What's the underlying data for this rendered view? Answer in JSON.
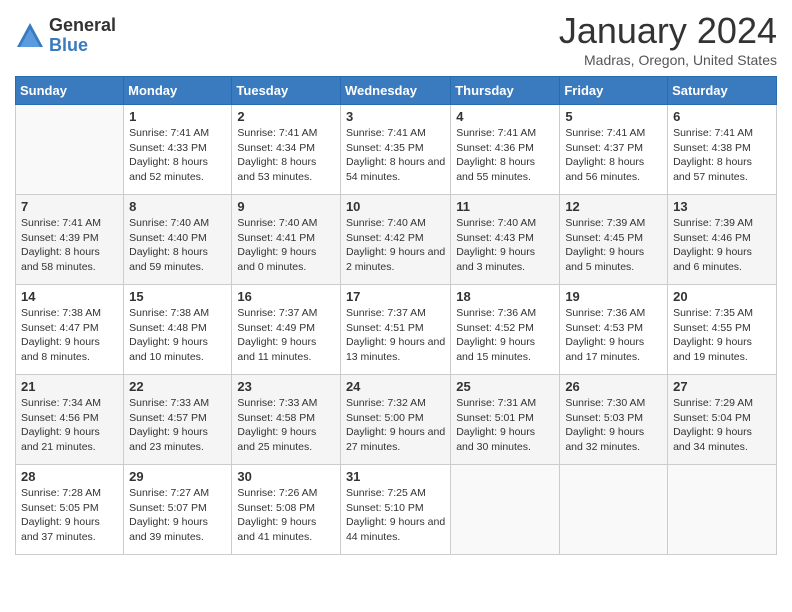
{
  "header": {
    "logo_general": "General",
    "logo_blue": "Blue",
    "title": "January 2024",
    "location": "Madras, Oregon, United States"
  },
  "days_of_week": [
    "Sunday",
    "Monday",
    "Tuesday",
    "Wednesday",
    "Thursday",
    "Friday",
    "Saturday"
  ],
  "weeks": [
    [
      {
        "day": "",
        "sunrise": "",
        "sunset": "",
        "daylight": ""
      },
      {
        "day": "1",
        "sunrise": "7:41 AM",
        "sunset": "4:33 PM",
        "daylight": "8 hours and 52 minutes."
      },
      {
        "day": "2",
        "sunrise": "7:41 AM",
        "sunset": "4:34 PM",
        "daylight": "8 hours and 53 minutes."
      },
      {
        "day": "3",
        "sunrise": "7:41 AM",
        "sunset": "4:35 PM",
        "daylight": "8 hours and 54 minutes."
      },
      {
        "day": "4",
        "sunrise": "7:41 AM",
        "sunset": "4:36 PM",
        "daylight": "8 hours and 55 minutes."
      },
      {
        "day": "5",
        "sunrise": "7:41 AM",
        "sunset": "4:37 PM",
        "daylight": "8 hours and 56 minutes."
      },
      {
        "day": "6",
        "sunrise": "7:41 AM",
        "sunset": "4:38 PM",
        "daylight": "8 hours and 57 minutes."
      }
    ],
    [
      {
        "day": "7",
        "sunrise": "7:41 AM",
        "sunset": "4:39 PM",
        "daylight": "8 hours and 58 minutes."
      },
      {
        "day": "8",
        "sunrise": "7:40 AM",
        "sunset": "4:40 PM",
        "daylight": "8 hours and 59 minutes."
      },
      {
        "day": "9",
        "sunrise": "7:40 AM",
        "sunset": "4:41 PM",
        "daylight": "9 hours and 0 minutes."
      },
      {
        "day": "10",
        "sunrise": "7:40 AM",
        "sunset": "4:42 PM",
        "daylight": "9 hours and 2 minutes."
      },
      {
        "day": "11",
        "sunrise": "7:40 AM",
        "sunset": "4:43 PM",
        "daylight": "9 hours and 3 minutes."
      },
      {
        "day": "12",
        "sunrise": "7:39 AM",
        "sunset": "4:45 PM",
        "daylight": "9 hours and 5 minutes."
      },
      {
        "day": "13",
        "sunrise": "7:39 AM",
        "sunset": "4:46 PM",
        "daylight": "9 hours and 6 minutes."
      }
    ],
    [
      {
        "day": "14",
        "sunrise": "7:38 AM",
        "sunset": "4:47 PM",
        "daylight": "9 hours and 8 minutes."
      },
      {
        "day": "15",
        "sunrise": "7:38 AM",
        "sunset": "4:48 PM",
        "daylight": "9 hours and 10 minutes."
      },
      {
        "day": "16",
        "sunrise": "7:37 AM",
        "sunset": "4:49 PM",
        "daylight": "9 hours and 11 minutes."
      },
      {
        "day": "17",
        "sunrise": "7:37 AM",
        "sunset": "4:51 PM",
        "daylight": "9 hours and 13 minutes."
      },
      {
        "day": "18",
        "sunrise": "7:36 AM",
        "sunset": "4:52 PM",
        "daylight": "9 hours and 15 minutes."
      },
      {
        "day": "19",
        "sunrise": "7:36 AM",
        "sunset": "4:53 PM",
        "daylight": "9 hours and 17 minutes."
      },
      {
        "day": "20",
        "sunrise": "7:35 AM",
        "sunset": "4:55 PM",
        "daylight": "9 hours and 19 minutes."
      }
    ],
    [
      {
        "day": "21",
        "sunrise": "7:34 AM",
        "sunset": "4:56 PM",
        "daylight": "9 hours and 21 minutes."
      },
      {
        "day": "22",
        "sunrise": "7:33 AM",
        "sunset": "4:57 PM",
        "daylight": "9 hours and 23 minutes."
      },
      {
        "day": "23",
        "sunrise": "7:33 AM",
        "sunset": "4:58 PM",
        "daylight": "9 hours and 25 minutes."
      },
      {
        "day": "24",
        "sunrise": "7:32 AM",
        "sunset": "5:00 PM",
        "daylight": "9 hours and 27 minutes."
      },
      {
        "day": "25",
        "sunrise": "7:31 AM",
        "sunset": "5:01 PM",
        "daylight": "9 hours and 30 minutes."
      },
      {
        "day": "26",
        "sunrise": "7:30 AM",
        "sunset": "5:03 PM",
        "daylight": "9 hours and 32 minutes."
      },
      {
        "day": "27",
        "sunrise": "7:29 AM",
        "sunset": "5:04 PM",
        "daylight": "9 hours and 34 minutes."
      }
    ],
    [
      {
        "day": "28",
        "sunrise": "7:28 AM",
        "sunset": "5:05 PM",
        "daylight": "9 hours and 37 minutes."
      },
      {
        "day": "29",
        "sunrise": "7:27 AM",
        "sunset": "5:07 PM",
        "daylight": "9 hours and 39 minutes."
      },
      {
        "day": "30",
        "sunrise": "7:26 AM",
        "sunset": "5:08 PM",
        "daylight": "9 hours and 41 minutes."
      },
      {
        "day": "31",
        "sunrise": "7:25 AM",
        "sunset": "5:10 PM",
        "daylight": "9 hours and 44 minutes."
      },
      {
        "day": "",
        "sunrise": "",
        "sunset": "",
        "daylight": ""
      },
      {
        "day": "",
        "sunrise": "",
        "sunset": "",
        "daylight": ""
      },
      {
        "day": "",
        "sunrise": "",
        "sunset": "",
        "daylight": ""
      }
    ]
  ],
  "labels": {
    "sunrise_prefix": "Sunrise: ",
    "sunset_prefix": "Sunset: ",
    "daylight_prefix": "Daylight: "
  }
}
